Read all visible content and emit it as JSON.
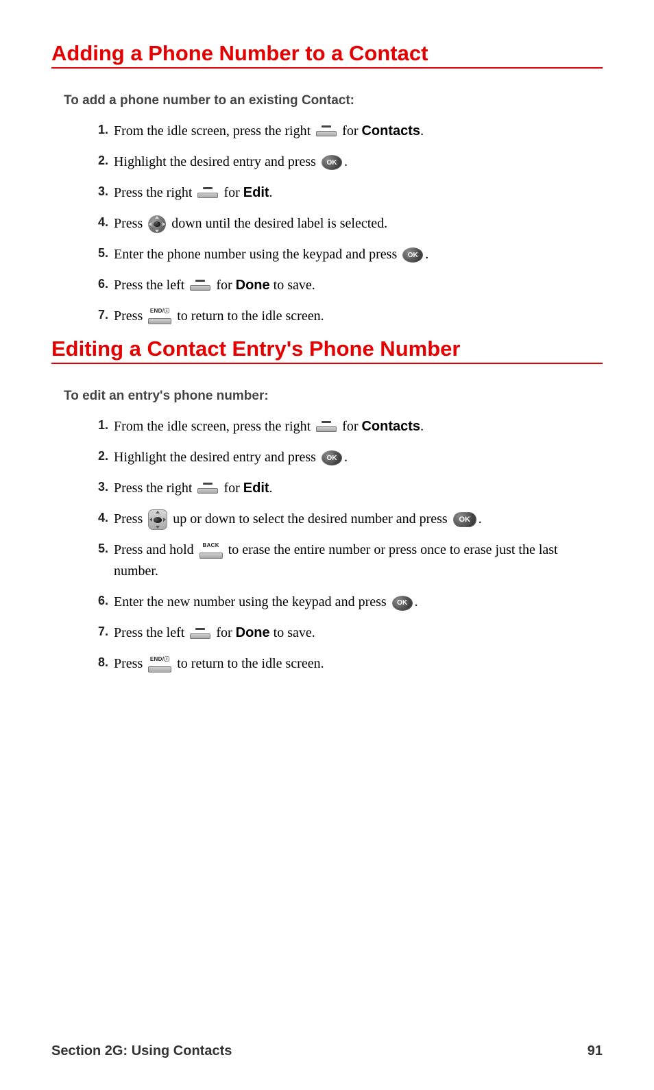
{
  "section1": {
    "heading": "Adding a Phone Number to a Contact",
    "lead": "To add a phone number to an existing Contact:",
    "steps": {
      "s1a": "From the idle screen, press the right ",
      "s1b": " for ",
      "s1c": "Contacts",
      "s1d": ".",
      "s2a": "Highlight the desired entry and press ",
      "s2b": ".",
      "s3a": "Press the right ",
      "s3b": " for ",
      "s3c": "Edit",
      "s3d": ".",
      "s4a": "Press ",
      "s4b": " down until the desired label is selected.",
      "s5a": "Enter the phone number using the keypad and press ",
      "s5b": ".",
      "s6a": "Press the left ",
      "s6b": " for ",
      "s6c": "Done",
      "s6d": " to save.",
      "s7a": "Press ",
      "s7b": " to return to the idle screen."
    }
  },
  "section2": {
    "heading": "Editing a Contact Entry's Phone Number",
    "lead": "To edit an entry's phone number:",
    "steps": {
      "s1a": "From the idle screen, press the right ",
      "s1b": " for ",
      "s1c": "Contacts",
      "s1d": ".",
      "s2a": "Highlight the desired entry and press ",
      "s2b": ".",
      "s3a": "Press the right ",
      "s3b": " for ",
      "s3c": "Edit",
      "s3d": ".",
      "s4a": "Press ",
      "s4b": " up or down to select the desired number and press ",
      "s4c": ".",
      "s5a": "Press and hold ",
      "s5b": " to erase the entire number or press once to erase just the last number.",
      "s6a": "Enter the new number using the keypad and press ",
      "s6b": ".",
      "s7a": "Press the left ",
      "s7b": " for ",
      "s7c": "Done",
      "s7d": " to save.",
      "s8a": "Press ",
      "s8b": " to return to the idle screen."
    }
  },
  "icons": {
    "ok": "OK",
    "end": "END/ⓘ",
    "back": "BACK"
  },
  "footer": {
    "left": "Section 2G: Using Contacts",
    "right": "91"
  }
}
